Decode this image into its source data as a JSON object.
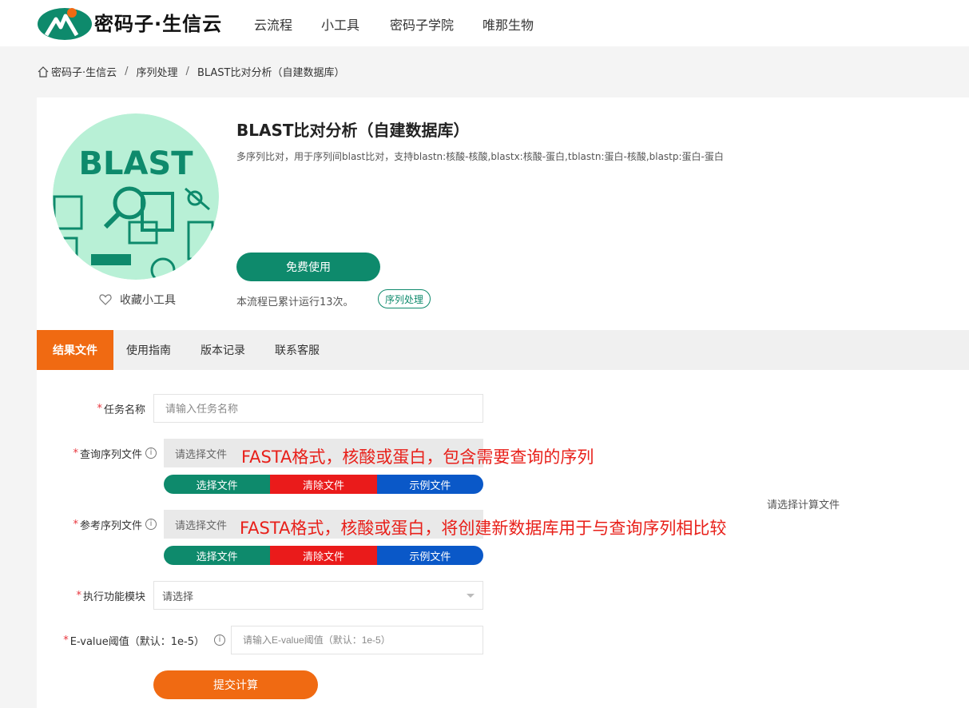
{
  "header": {
    "brand": "密码子·生信云",
    "nav": [
      "云流程",
      "小工具",
      "密码子学院",
      "唯那生物"
    ]
  },
  "breadcrumb": [
    "密码子·生信云",
    "序列处理",
    "BLAST比对分析（自建数据库）"
  ],
  "tool": {
    "logo_text": "BLAST",
    "title": "BLAST比对分析（自建数据库）",
    "description": "多序列比对，用于序列间blast比对，支持blastn:核酸-核酸,blastx:核酸-蛋白,tblastn:蛋白-核酸,blastp:蛋白-蛋白",
    "free_label": "免费使用",
    "favorite_label": "收藏小工具",
    "run_count_text": "本流程已累计运行13次。",
    "category_tag": "序列处理"
  },
  "tabs": [
    "结果文件",
    "使用指南",
    "版本记录",
    "联系客服"
  ],
  "form": {
    "task_name": {
      "label": "任务名称",
      "placeholder": "请输入任务名称"
    },
    "query_file": {
      "label": "查询序列文件",
      "placeholder": "请选择文件",
      "note": "FASTA格式，核酸或蛋白，包含需要查询的序列"
    },
    "ref_file": {
      "label": "参考序列文件",
      "placeholder": "请选择文件",
      "note": "FASTA格式，核酸或蛋白，将创建新数据库用于与查询序列相比较"
    },
    "file_buttons": {
      "choose": "选择文件",
      "clear": "清除文件",
      "example": "示例文件"
    },
    "module": {
      "label": "执行功能模块",
      "placeholder": "请选择"
    },
    "evalue": {
      "label": "E-value阈值（默认：1e-5）",
      "placeholder": "请输入E-value阈值（默认：1e-5）"
    },
    "info_glyph": "i",
    "side_hint": "请选择计算文件",
    "required_mark": "*",
    "submit_label": "提交计算"
  },
  "colors": {
    "green": "#0e8a6c",
    "orange": "#f06a12",
    "red": "#ea1b1b",
    "blue": "#0a58c8",
    "logo_bg": "#b8f0d6"
  }
}
